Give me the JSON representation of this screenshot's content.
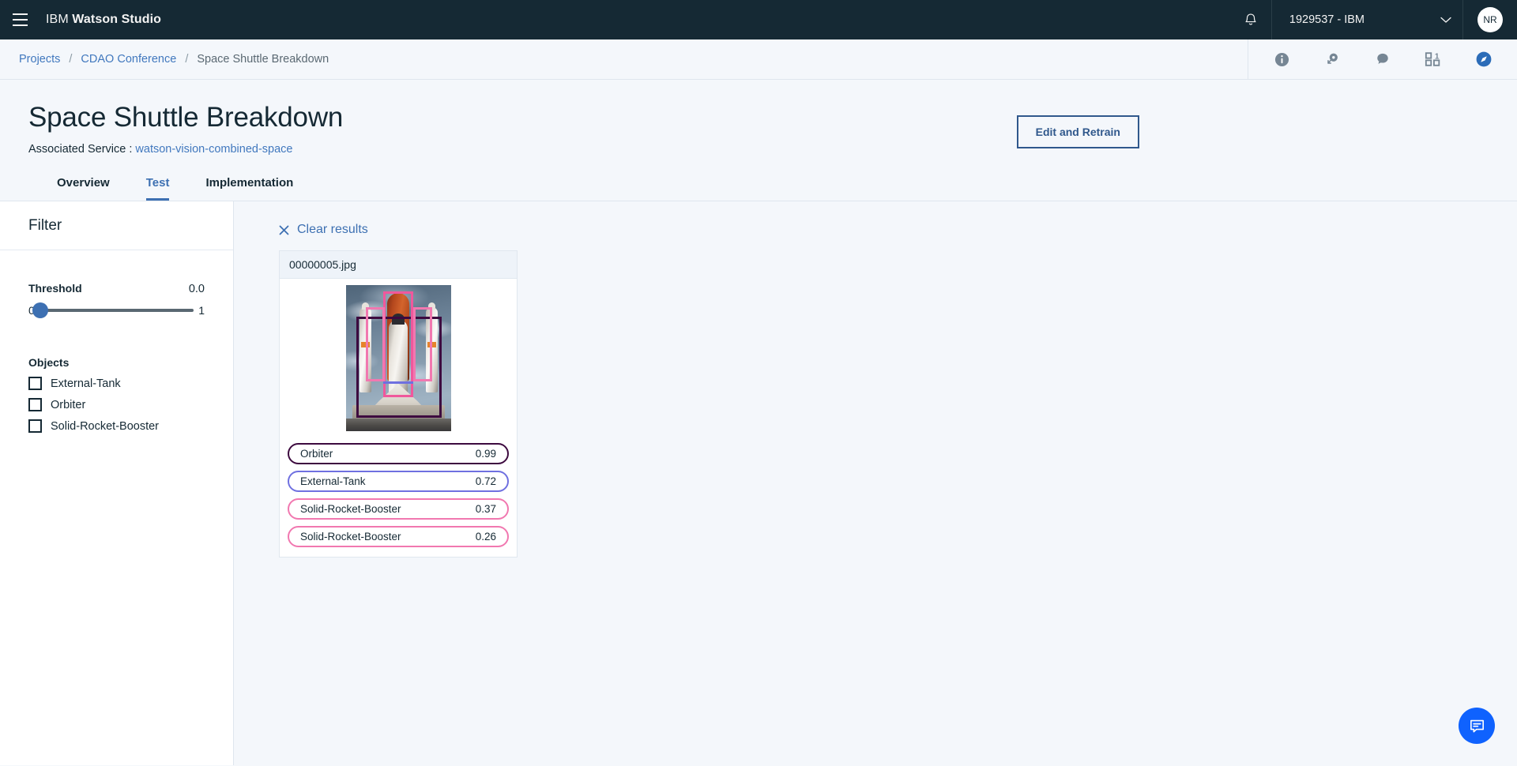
{
  "topnav": {
    "menu_icon": "hamburger-menu-icon",
    "brand_prefix": "IBM",
    "brand_name": "Watson Studio",
    "bell_icon": "notification-bell-icon",
    "account": "1929537 - IBM",
    "account_chevron": "chevron-down-icon",
    "avatar_initials": "NR"
  },
  "breadcrumb": {
    "items": [
      {
        "label": "Projects",
        "link": true
      },
      {
        "label": "CDAO Conference",
        "link": true
      },
      {
        "label": "Space Shuttle Breakdown",
        "link": false
      }
    ],
    "separator": "/",
    "actions": [
      {
        "name": "info-icon",
        "label": "Information"
      },
      {
        "name": "tag-search-icon",
        "label": "Find tags"
      },
      {
        "name": "comment-icon",
        "label": "Comments"
      },
      {
        "name": "grid-count-icon",
        "label": "Collaborators",
        "badge": "1"
      },
      {
        "name": "compass-icon",
        "label": "Navigator"
      }
    ]
  },
  "page": {
    "title": "Space Shuttle Breakdown",
    "associated_service_label": "Associated Service :",
    "associated_service_name": "watson-vision-combined-space",
    "retrain_button": "Edit and Retrain"
  },
  "tabs": [
    {
      "label": "Overview",
      "active": false
    },
    {
      "label": "Test",
      "active": true
    },
    {
      "label": "Implementation",
      "active": false
    }
  ],
  "filter": {
    "title": "Filter",
    "threshold": {
      "label": "Threshold",
      "value": "0.0",
      "min_label": "0",
      "max_label": "1",
      "position_pct": 0
    },
    "objects_title": "Objects",
    "objects": [
      {
        "label": "External-Tank",
        "checked": false
      },
      {
        "label": "Orbiter",
        "checked": false
      },
      {
        "label": "Solid-Rocket-Booster",
        "checked": false
      }
    ]
  },
  "results": {
    "clear_label": "Clear results",
    "clear_icon": "close-x-icon",
    "card": {
      "filename": "00000005.jpg",
      "image_alt": "space-shuttle-on-launch-pad",
      "detections": [
        {
          "label": "Orbiter",
          "score": "0.99",
          "color": "#3d0a3f"
        },
        {
          "label": "External-Tank",
          "score": "0.72",
          "color": "#6f70e0"
        },
        {
          "label": "Solid-Rocket-Booster",
          "score": "0.37",
          "color": "#f178b0"
        },
        {
          "label": "Solid-Rocket-Booster",
          "score": "0.26",
          "color": "#f178b0"
        }
      ]
    }
  },
  "chat_fab": {
    "icon": "chat-bubble-icon",
    "color": "#0f62fe"
  },
  "colors": {
    "nav_bg": "#152934",
    "page_bg": "#f4f7fb",
    "link": "#4178be",
    "accent": "#3d70b2",
    "button_border": "#30588c"
  }
}
